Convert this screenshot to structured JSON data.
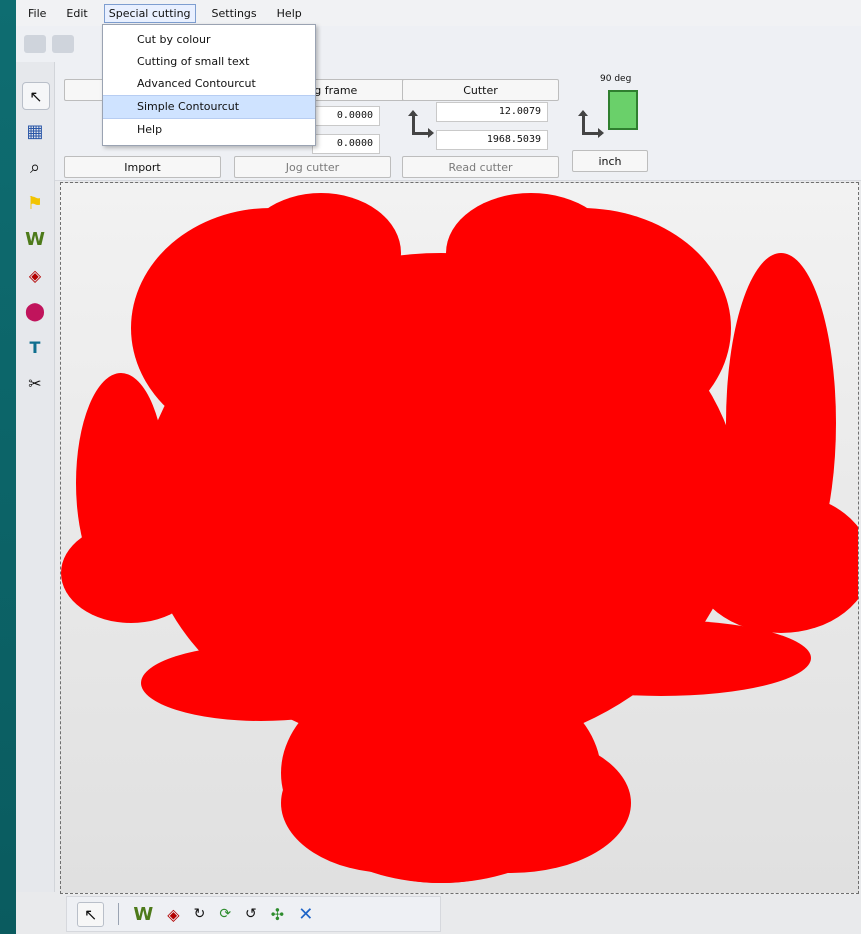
{
  "menubar": {
    "items": [
      "File",
      "Edit",
      "Special cutting",
      "Settings",
      "Help"
    ],
    "active_index": 2
  },
  "dropdown": {
    "items": [
      "Cut by colour",
      "Cutting of small text",
      "Advanced Contourcut",
      "Simple Contourcut",
      "Help"
    ],
    "hover_index": 3
  },
  "controls": {
    "framing_frame_label": "ring frame",
    "cutter_label": "Cutter",
    "import_label": "Import",
    "jog_cutter_label": "Jog cutter",
    "read_cutter_label": "Read cutter",
    "unit_label": "inch",
    "left_x_value": "0.0000",
    "left_y_value": "0.0000",
    "right_x_value": "12.0079",
    "right_y_value": "1968.5039",
    "rotation_label": "90 deg"
  },
  "colors": {
    "shape": "#ff0000",
    "menu_active": "#7e9ed0",
    "dropdown_hover": "#cfe3ff"
  },
  "icons": {
    "left_tools": [
      "pointer-icon",
      "grid-icon",
      "zoom-icon",
      "flag-icon",
      "weed-icon",
      "registration-mark-icon",
      "fill-icon",
      "text-icon",
      "scissors-icon"
    ],
    "bottom_tools": [
      "pointer-icon",
      "weed-icon",
      "registration-mark-icon",
      "rotate-90-icon",
      "rotate-icon",
      "rotate-0-icon",
      "move-icon",
      "delete-icon"
    ]
  }
}
